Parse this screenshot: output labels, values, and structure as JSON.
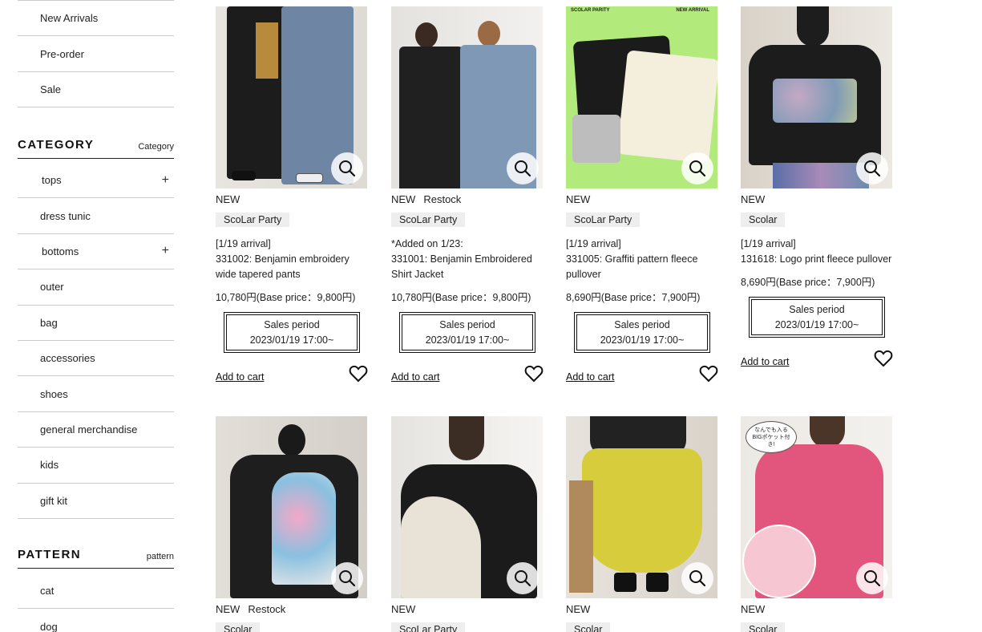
{
  "sidebar": {
    "top_items": [
      "New Arrivals",
      "Pre-order",
      "Sale"
    ],
    "category": {
      "title": "CATEGORY",
      "subtitle": "Category",
      "items": [
        "tops",
        "dress tunic",
        "bottoms",
        "outer",
        "bag",
        "accessories",
        "shoes",
        "general merchandise",
        "kids",
        "gift kit"
      ]
    },
    "pattern": {
      "title": "PATTERN",
      "subtitle": "pattern",
      "items": [
        "cat",
        "dog"
      ]
    }
  },
  "labels": {
    "add_to_cart": "Add to cart",
    "sales_period": "Sales period"
  },
  "products": [
    {
      "badges": [
        "NEW"
      ],
      "brand": "ScoLar Party",
      "name_lines": [
        "[1/19 arrival]",
        "331002: Benjamin embroidery",
        "wide tapered pants"
      ],
      "price": "10,780円(Base price：9,800円)",
      "sales_date": "2023/01/19 17:00~"
    },
    {
      "badges": [
        "NEW",
        "Restock"
      ],
      "brand": "ScoLar Party",
      "name_lines": [
        "*Added on 1/23:",
        "331001: Benjamin Embroidered",
        "Shirt Jacket"
      ],
      "price": "10,780円(Base price：9,800円)",
      "sales_date": "2023/01/19 17:00~"
    },
    {
      "badges": [
        "NEW"
      ],
      "brand": "ScoLar Party",
      "name_lines": [
        "[1/19 arrival]",
        "331005: Graffiti pattern fleece",
        "pullover"
      ],
      "price": "8,690円(Base price：7,900円)",
      "sales_date": "2023/01/19 17:00~",
      "image_text": {
        "left": "SCOLAR PARITY",
        "right": "NEW ARRIVAL"
      }
    },
    {
      "badges": [
        "NEW"
      ],
      "brand": "Scolar",
      "name_lines": [
        "[1/19 arrival]",
        "131618: Logo print fleece pullover"
      ],
      "price": "8,690円(Base price：7,900円)",
      "sales_date": "2023/01/19 17:00~"
    },
    {
      "badges": [
        "NEW",
        "Restock"
      ],
      "brand": "Scolar"
    },
    {
      "badges": [
        "NEW"
      ],
      "brand": "ScoLar Party"
    },
    {
      "badges": [
        "NEW"
      ],
      "brand": "Scolar"
    },
    {
      "badges": [
        "NEW"
      ],
      "brand": "Scolar",
      "image_text": {
        "bubble": "なんでも入る BIGポケット付き!"
      }
    }
  ]
}
